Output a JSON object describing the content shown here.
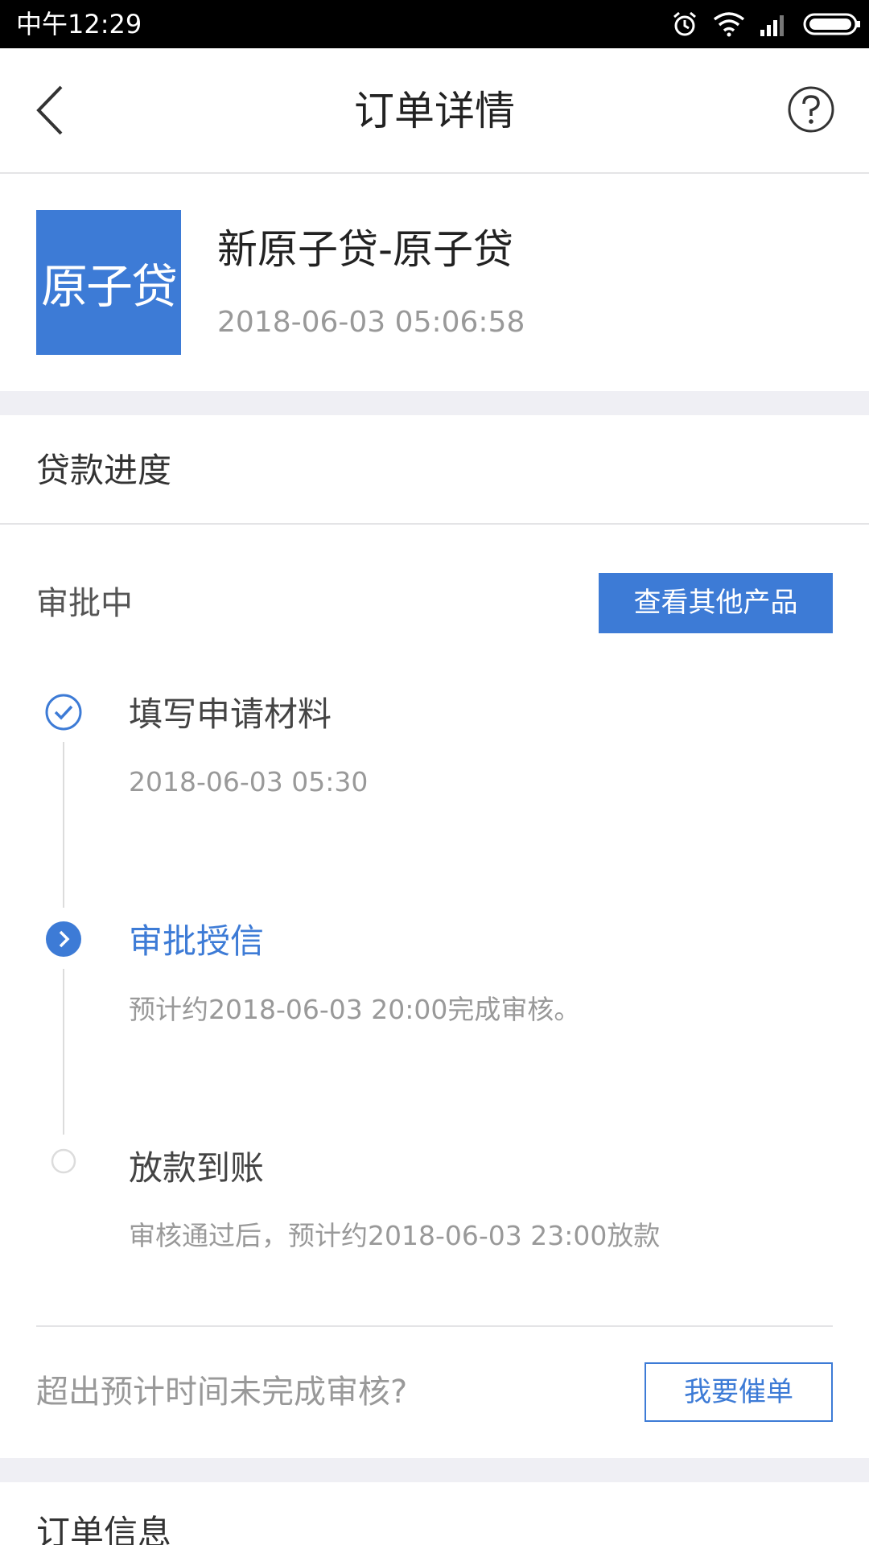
{
  "status_bar": {
    "time": "中午12:29",
    "icons": [
      "alarm-icon",
      "wifi-icon",
      "signal-icon",
      "battery-icon"
    ]
  },
  "header": {
    "title": "订单详情",
    "back_icon": "chevron-left-icon",
    "help_icon": "question-circle-icon"
  },
  "product": {
    "logo_text": "原子贷",
    "name": "新原子贷-原子贷",
    "date": "2018-06-03 05:06:58"
  },
  "progress": {
    "section_title": "贷款进度",
    "status": "审批中",
    "other_products_button": "查看其他产品",
    "steps": [
      {
        "title": "填写申请材料",
        "desc": "2018-06-03 05:30",
        "state": "done"
      },
      {
        "title": "审批授信",
        "desc": "预计约2018-06-03 20:00完成审核。",
        "state": "active"
      },
      {
        "title": "放款到账",
        "desc": "审核通过后，预计约2018-06-03 23:00放款",
        "state": "pending"
      }
    ],
    "urge_question": "超出预计时间未完成审核?",
    "urge_button": "我要催单"
  },
  "order_info": {
    "section_title": "订单信息"
  },
  "colors": {
    "accent": "#3d7bd6",
    "text_primary": "#222222",
    "text_secondary": "#999999",
    "divider": "#e4e4e6",
    "gap_background": "#efeff4"
  }
}
